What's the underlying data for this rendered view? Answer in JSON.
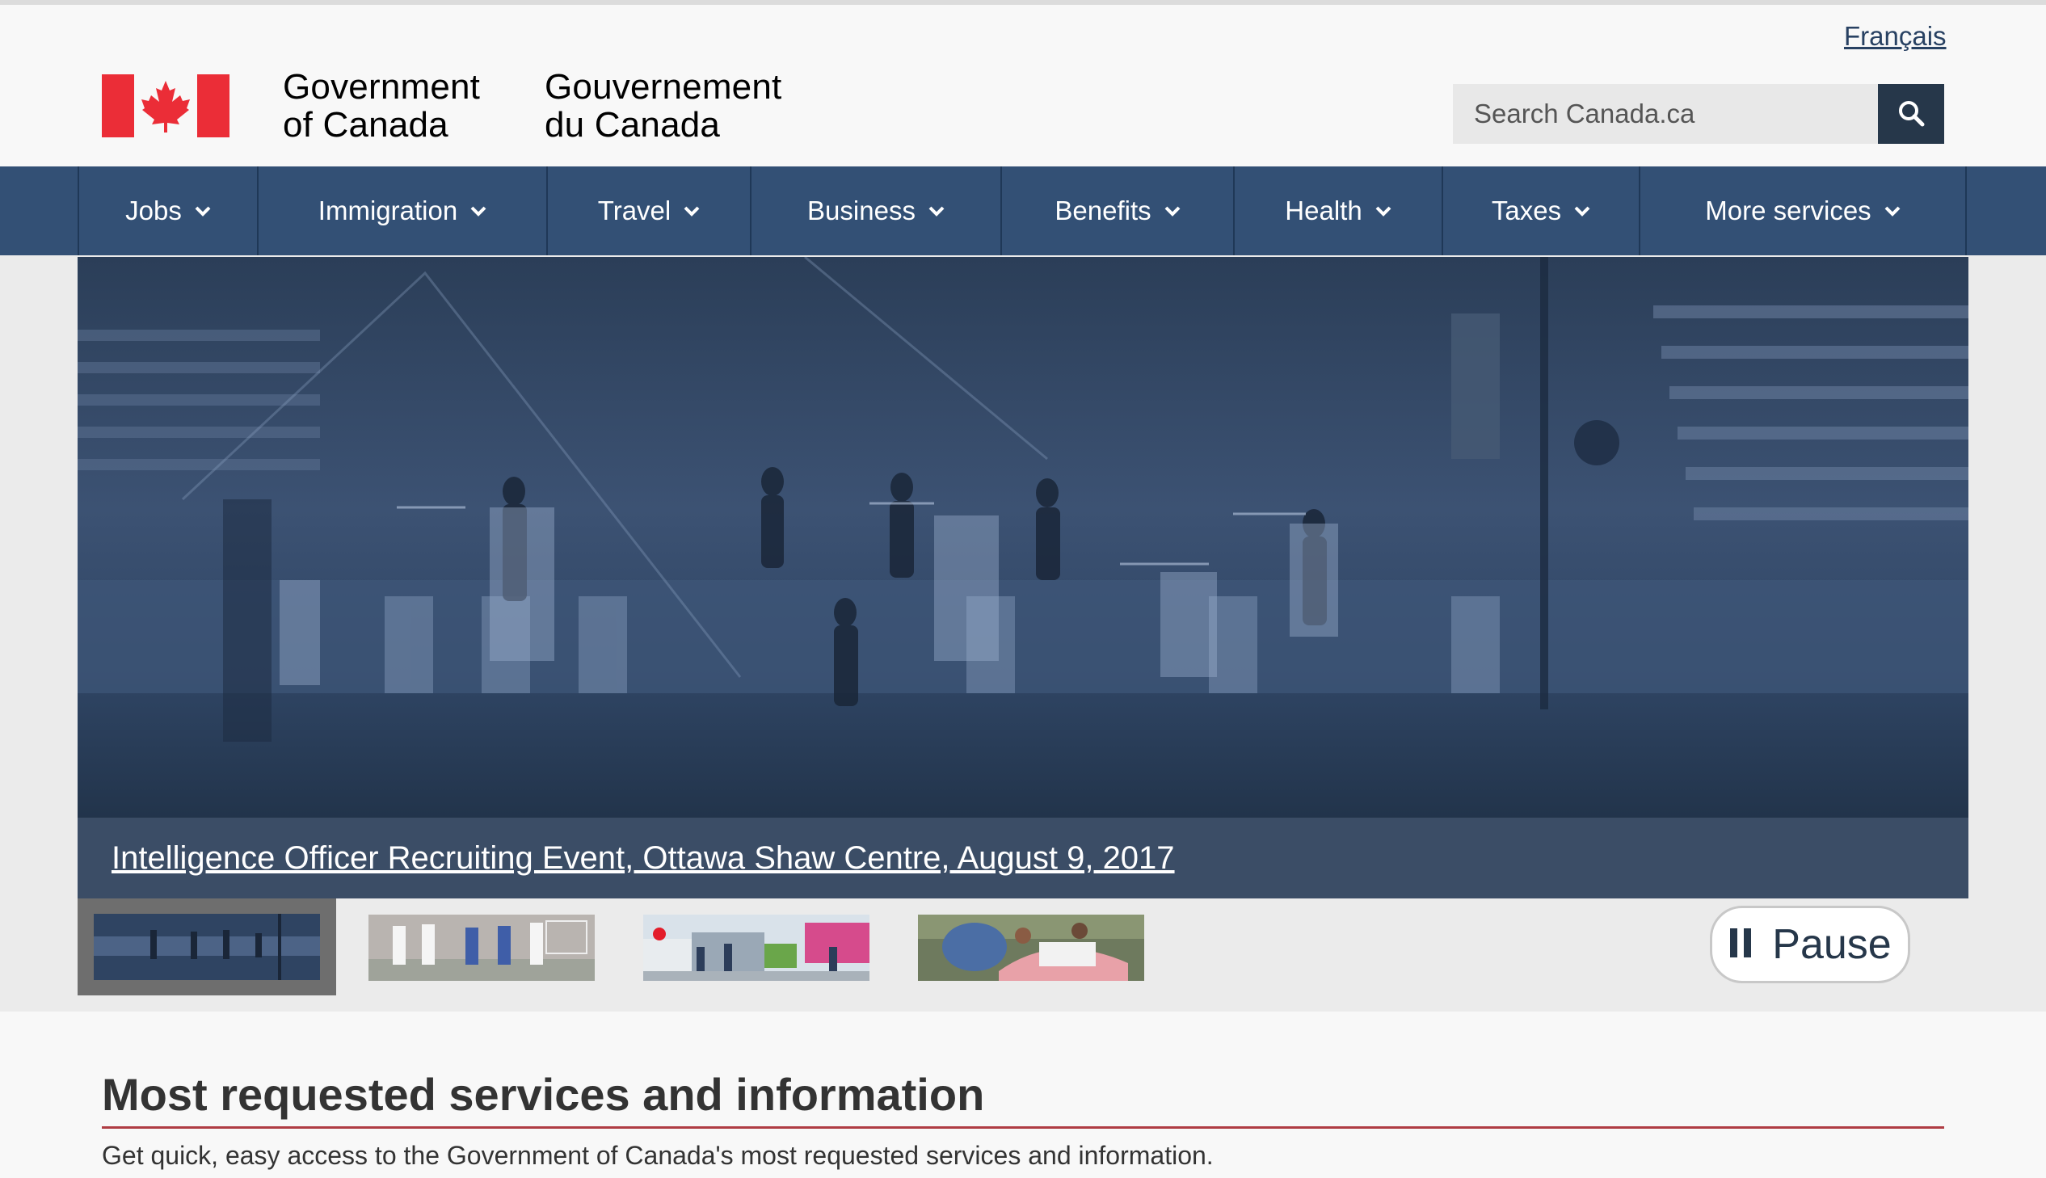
{
  "header": {
    "language_link": "Français",
    "wordmark_en_line1": "Government",
    "wordmark_en_line2": "of Canada",
    "wordmark_fr_line1": "Gouvernement",
    "wordmark_fr_line2": "du Canada",
    "search_placeholder": "Search Canada.ca",
    "search_icon": "search-icon",
    "flag_icon": "canada-flag-icon"
  },
  "menu": {
    "items": [
      {
        "label": "Jobs"
      },
      {
        "label": "Immigration"
      },
      {
        "label": "Travel"
      },
      {
        "label": "Business"
      },
      {
        "label": "Benefits"
      },
      {
        "label": "Health"
      },
      {
        "label": "Taxes"
      },
      {
        "label": "More services"
      }
    ],
    "chevron_icon": "chevron-down-icon"
  },
  "carousel": {
    "caption": "Intelligence Officer Recruiting Event, Ottawa Shaw Centre, August 9, 2017",
    "pause_label": "Pause",
    "pause_icon": "pause-icon",
    "active_slide": 1,
    "slide_count": 4
  },
  "section": {
    "title": "Most requested services and information",
    "lead": "Get quick, easy access to the Government of Canada's most requested services and information."
  },
  "colors": {
    "nav_bg": "#335075",
    "header_dark": "#26374a",
    "flag_red": "#eb2d37",
    "accent_rule": "#af3c43",
    "link": "#284162"
  }
}
